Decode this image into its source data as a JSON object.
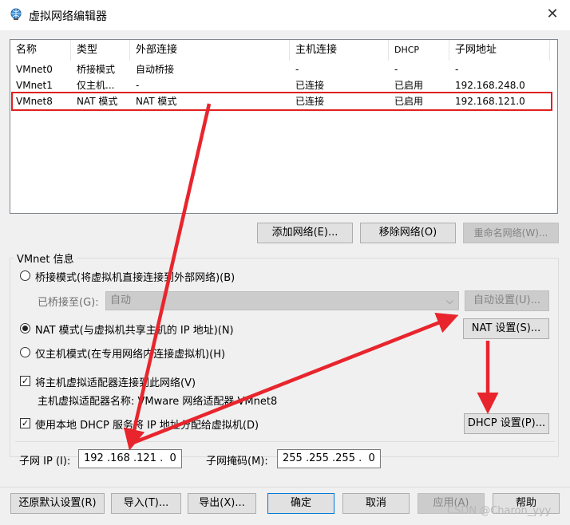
{
  "window": {
    "title": "虚拟网络编辑器"
  },
  "list": {
    "columns": [
      "名称",
      "类型",
      "外部连接",
      "主机连接",
      "DHCP",
      "子网地址"
    ],
    "rows": [
      [
        "VMnet0",
        "桥接模式",
        "自动桥接",
        "-",
        "-",
        "-"
      ],
      [
        "VMnet1",
        "仅主机...",
        "-",
        "已连接",
        "已启用",
        "192.168.248.0"
      ],
      [
        "VMnet8",
        "NAT 模式",
        "NAT 模式",
        "已连接",
        "已启用",
        "192.168.121.0"
      ]
    ],
    "selected_row": 2
  },
  "list_buttons": {
    "add": "添加网络(E)...",
    "remove": "移除网络(O)",
    "rename": "重命名网络(W)..."
  },
  "vmnet_info": {
    "title": "VMnet 信息",
    "bridge_mode": "桥接模式(将虚拟机直接连接到外部网络)(B)",
    "bridged_to_label": "已桥接至(G):",
    "bridged_to_value": "自动",
    "auto_settings": "自动设置(U)...",
    "nat_mode": "NAT 模式(与虚拟机共享主机的 IP 地址)(N)",
    "nat_settings": "NAT 设置(S)...",
    "host_only_mode": "仅主机模式(在专用网络内连接虚拟机)(H)",
    "connect_adapter": "将主机虚拟适配器连接到此网络(V)",
    "adapter_name": "主机虚拟适配器名称: VMware 网络适配器 VMnet8",
    "use_dhcp": "使用本地 DHCP 服务将 IP 地址分配给虚拟机(D)",
    "dhcp_settings": "DHCP 设置(P)...",
    "subnet_ip_label": "子网 IP (I):",
    "subnet_ip_value": "192 .168 .121 .  0",
    "subnet_mask_label": "子网掩码(M):",
    "subnet_mask_value": "255 .255 .255 .  0",
    "selected_mode": "nat",
    "connect_adapter_checked": true,
    "use_dhcp_checked": true
  },
  "footer": {
    "restore": "还原默认设置(R)",
    "import": "导入(T)...",
    "export": "导出(X)...",
    "ok": "确定",
    "cancel": "取消",
    "apply": "应用(A)",
    "help": "帮助"
  },
  "watermark": "CSDN @Charon_yyy",
  "colors": {
    "highlight_border": "#e02020",
    "annotation_arrow": "#e8252d"
  }
}
